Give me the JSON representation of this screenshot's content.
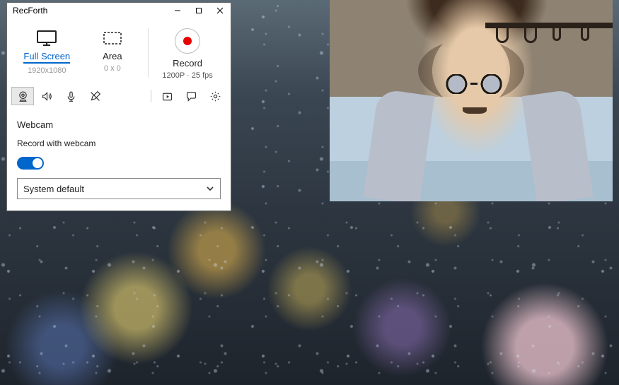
{
  "app": {
    "title": "RecForth"
  },
  "modes": {
    "fullscreen": {
      "label": "Full Screen",
      "resolution": "1920x1080"
    },
    "area": {
      "label": "Area",
      "resolution": "0 x 0"
    }
  },
  "record": {
    "label": "Record",
    "info": "1200P · 25 fps"
  },
  "toolbar": {
    "webcam_icon": "webcam-icon",
    "speaker_icon": "speaker-icon",
    "mic_icon": "mic-icon",
    "pen_icon": "pen-icon",
    "library_icon": "library-icon",
    "chat_icon": "chat-icon",
    "gear_icon": "gear-icon"
  },
  "webcam_panel": {
    "heading": "Webcam",
    "toggle_label": "Record with webcam",
    "toggle_on": true,
    "device_selected": "System default"
  }
}
